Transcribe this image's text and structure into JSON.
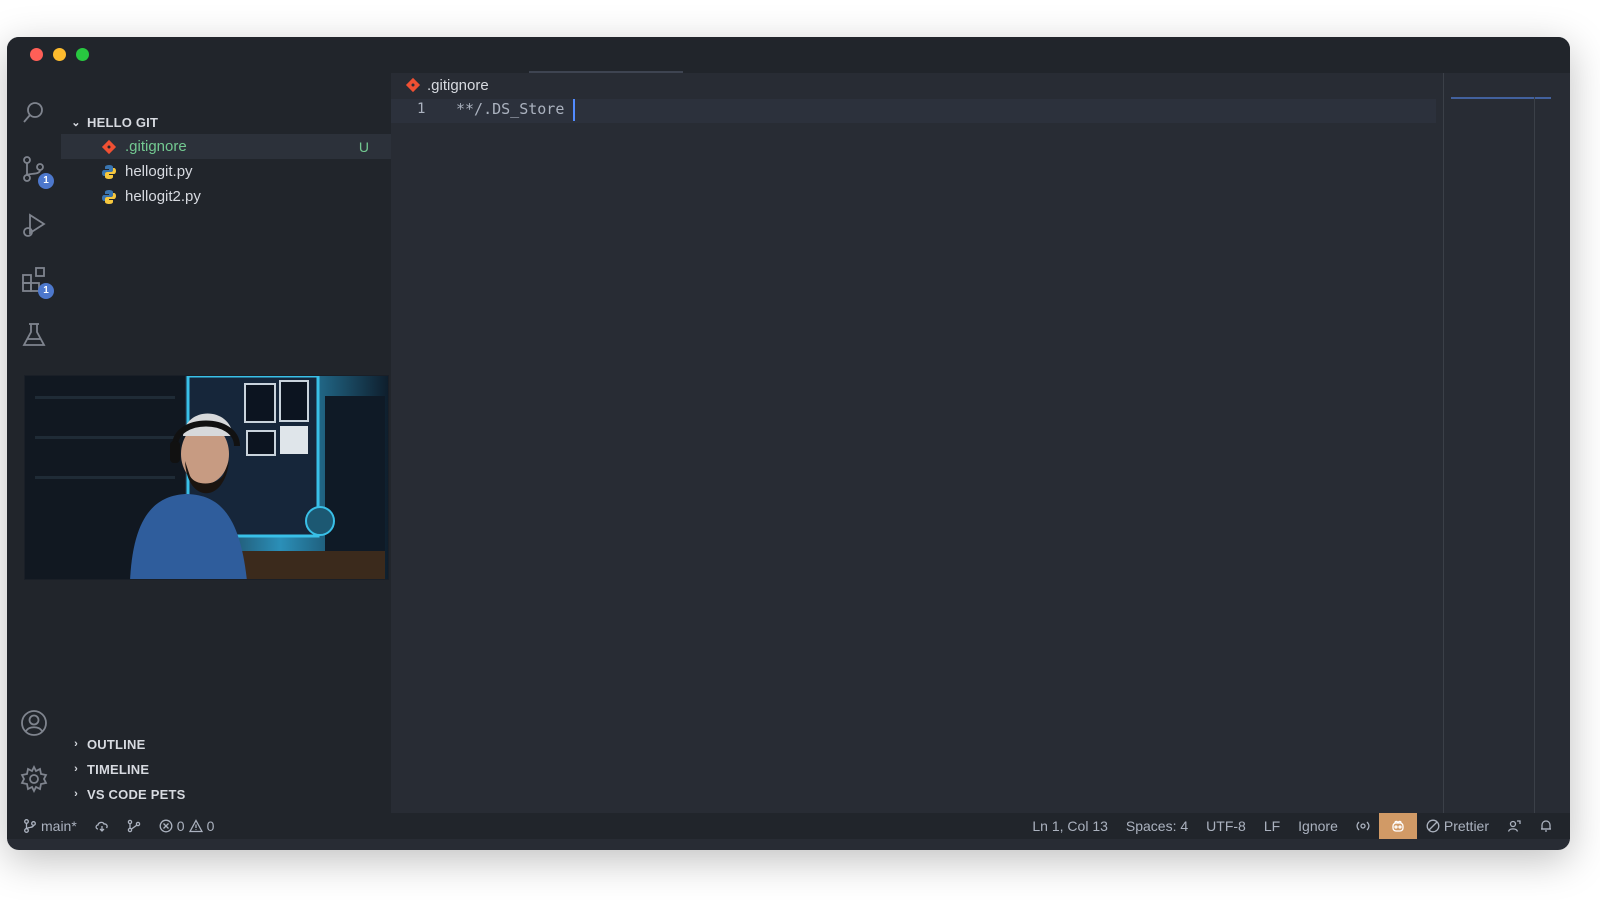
{
  "explorer": {
    "folder_name": "HELLO GIT",
    "files": [
      {
        "name": ".gitignore",
        "status": "U",
        "icon": "git-icon",
        "active": true
      },
      {
        "name": "hellogit.py",
        "status": "",
        "icon": "python-icon",
        "active": false
      },
      {
        "name": "hellogit2.py",
        "status": "",
        "icon": "python-icon",
        "active": false
      }
    ],
    "collapsed_sections": [
      "OUTLINE",
      "TIMELINE",
      "VS CODE PETS"
    ]
  },
  "activity_bar": {
    "source_control_badge": "1",
    "extensions_badge": "1"
  },
  "editor": {
    "tab_label": ".gitignore",
    "line_number": "1",
    "code_line": "**/.DS_Store"
  },
  "status_bar": {
    "branch": "main*",
    "errors": "0",
    "warnings": "0",
    "cursor_position": "Ln 1, Col 13",
    "indentation": "Spaces: 4",
    "encoding": "UTF-8",
    "line_ending": "LF",
    "language": "Ignore",
    "formatter": "Prettier"
  },
  "colors": {
    "editor_bg": "#282c34",
    "sidebar_bg": "#21252b",
    "untracked": "#73c991",
    "badge": "#4d78cc",
    "git_orange": "#f05033",
    "copilot_bg": "#d19a66"
  }
}
